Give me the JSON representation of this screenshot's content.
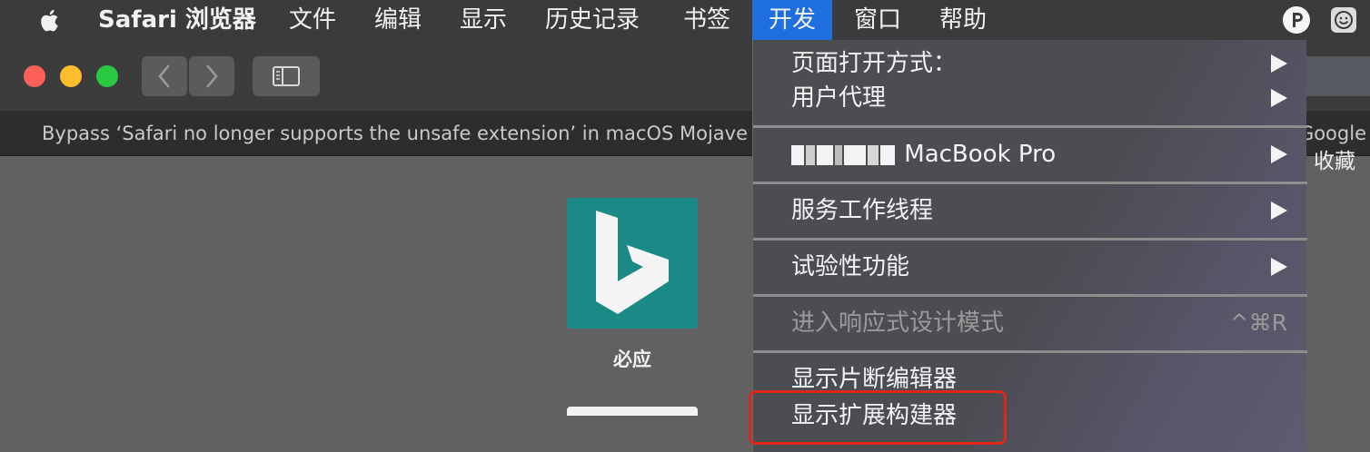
{
  "menubar": {
    "app_name": "Safari 浏览器",
    "items": [
      "文件",
      "编辑",
      "显示",
      "历史记录",
      "书签",
      "开发",
      "窗口",
      "帮助"
    ],
    "active_item": "开发"
  },
  "tab": {
    "title": "Bypass ‘Safari no longer supports the unsafe extension’ in macOS Mojave – C",
    "title_right": "Google"
  },
  "favorites": {
    "right_label": "收藏",
    "items": [
      {
        "name": "必应",
        "icon": "bing-logo",
        "color": "#1b8a86"
      }
    ]
  },
  "develop_menu": {
    "items": [
      {
        "label": "页面打开方式：",
        "submenu": true
      },
      {
        "label": "用户代理",
        "submenu": true
      },
      {
        "label": "MacBook Pro",
        "submenu": true,
        "redacted_prefix": true
      },
      {
        "label": "服务工作线程",
        "submenu": true
      },
      {
        "label": "试验性功能",
        "submenu": true
      },
      {
        "label": "进入响应式设计模式",
        "shortcut": "^⌘R",
        "disabled": true
      },
      {
        "label": "显示片断编辑器"
      },
      {
        "label": "显示扩展构建器",
        "highlighted": true
      }
    ]
  },
  "colors": {
    "menu_active": "#1f6fe0",
    "highlight_outline": "#e0251c",
    "traffic_red": "#fe5f57",
    "traffic_yellow": "#febc2e",
    "traffic_green": "#28c840"
  }
}
